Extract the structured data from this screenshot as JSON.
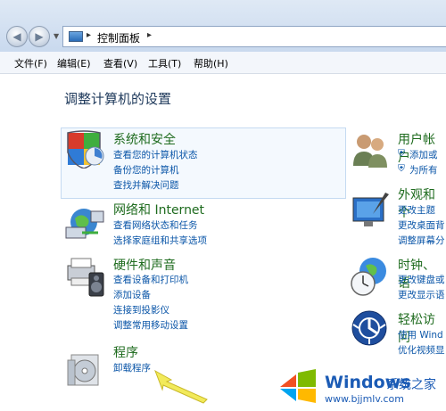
{
  "address": {
    "breadcrumb": "控制面板",
    "separator": "▸"
  },
  "menu": [
    "文件(F)",
    "编辑(E)",
    "查看(V)",
    "工具(T)",
    "帮助(H)"
  ],
  "heading": "调整计算机的设置",
  "categories": {
    "system_security": {
      "title": "系统和安全",
      "links": [
        "查看您的计算机状态",
        "备份您的计算机",
        "查找并解决问题"
      ]
    },
    "network": {
      "title": "网络和 Internet",
      "links": [
        "查看网络状态和任务",
        "选择家庭组和共享选项"
      ]
    },
    "hardware": {
      "title": "硬件和声音",
      "links": [
        "查看设备和打印机",
        "添加设备",
        "连接到投影仪",
        "调整常用移动设置"
      ]
    },
    "programs": {
      "title": "程序",
      "links": [
        "卸载程序"
      ]
    },
    "user_accounts": {
      "title": "用户帐户",
      "links": [
        "添加或",
        "为所有"
      ]
    },
    "appearance": {
      "title": "外观和个",
      "links": [
        "更改主题",
        "更改桌面背",
        "调整屏幕分"
      ]
    },
    "clock": {
      "title": "时钟、语",
      "links": [
        "更改键盘或",
        "更改显示语"
      ]
    },
    "ease": {
      "title": "轻松访问",
      "links": [
        "使用 Wind",
        "优化视频显"
      ]
    }
  },
  "watermark": {
    "brand": "Windows",
    "brand_cn": "系统之家",
    "url": "www.bjjmlv.com"
  }
}
